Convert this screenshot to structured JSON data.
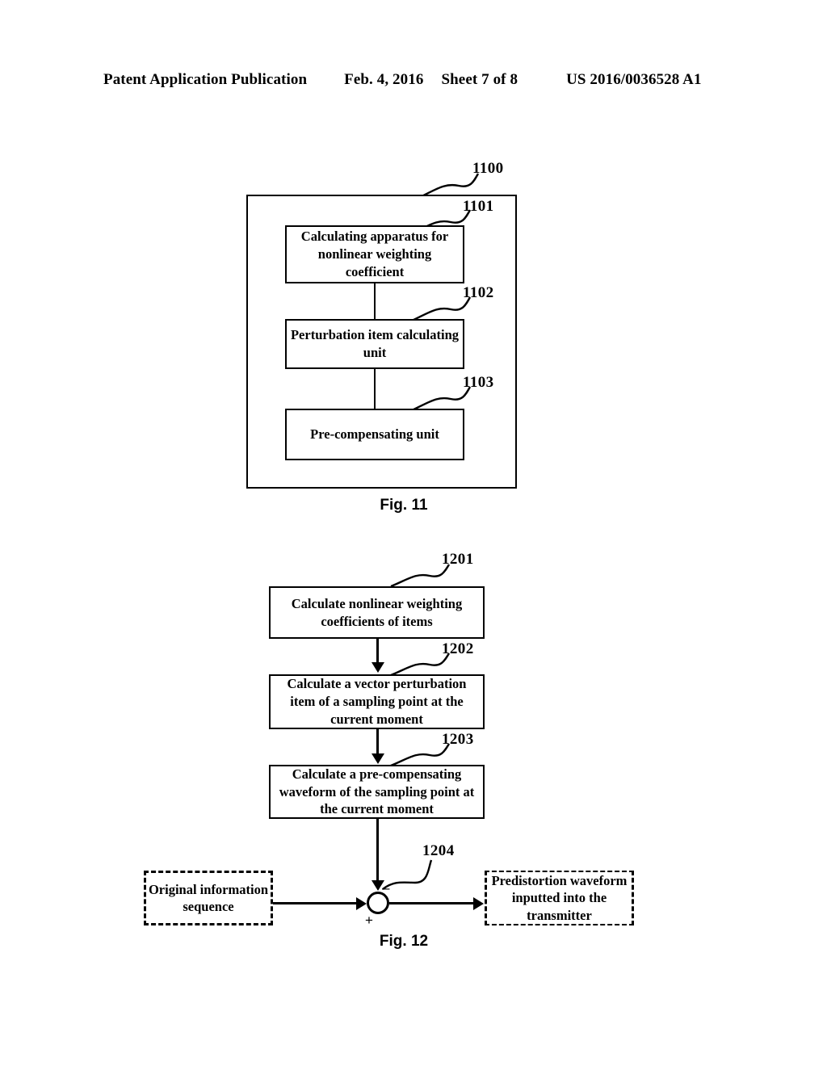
{
  "header": {
    "publication": "Patent Application Publication",
    "date": "Feb. 4, 2016",
    "sheet": "Sheet 7 of 8",
    "number": "US 2016/0036528 A1"
  },
  "figures": [
    {
      "caption": "Fig. 11",
      "type": "block-diagram",
      "container_ref": "1100",
      "blocks": [
        {
          "ref": "1101",
          "label": "Calculating apparatus for nonlinear weighting coefficient"
        },
        {
          "ref": "1102",
          "label": "Perturbation item calculating unit"
        },
        {
          "ref": "1103",
          "label": "Pre-compensating unit"
        }
      ]
    },
    {
      "caption": "Fig. 12",
      "type": "flowchart",
      "steps": [
        {
          "ref": "1201",
          "label": "Calculate nonlinear weighting coefficients of items"
        },
        {
          "ref": "1202",
          "label": "Calculate a vector perturbation item of a sampling point at the current moment"
        },
        {
          "ref": "1203",
          "label": "Calculate a pre-compensating waveform of the sampling point at the current moment"
        }
      ],
      "junction": {
        "ref": "1204",
        "minus_sign": "–",
        "plus_sign": "+"
      },
      "input_block": "Original information sequence",
      "output_block": "Predistortion waveform inputted into the transmitter"
    }
  ]
}
